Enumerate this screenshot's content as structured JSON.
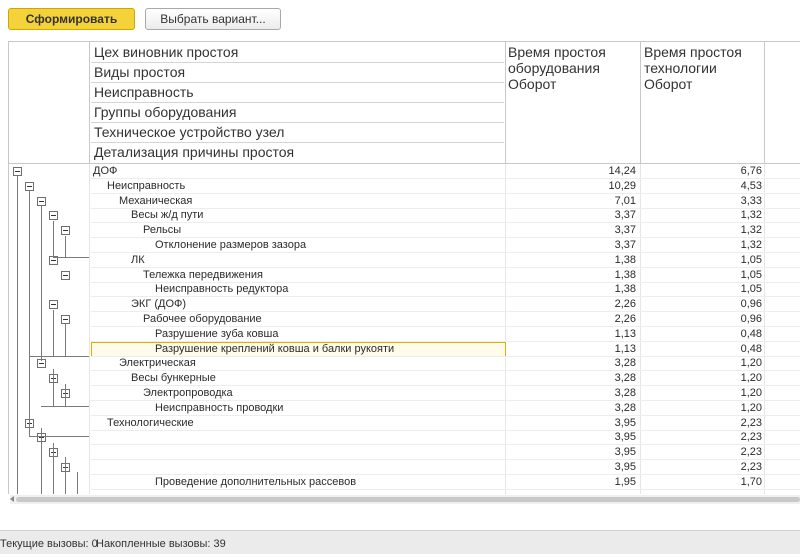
{
  "toolbar": {
    "generate_label": "Сформировать",
    "choose_variant_label": "Выбрать вариант..."
  },
  "header": {
    "groupings": [
      "Цех виновник простоя",
      "Виды простоя",
      "Неисправность",
      "Группы оборудования",
      "Техническое устройство узел",
      "Детализация причины простоя"
    ],
    "col1": "Время простоя\nоборудования\nОборот",
    "col2": "Время простоя\nтехнологии\nОборот"
  },
  "rows": [
    {
      "label": "ДОФ",
      "level": 0,
      "v1": "14,24",
      "v2": "6,76"
    },
    {
      "label": "Неисправность",
      "level": 1,
      "v1": "10,29",
      "v2": "4,53"
    },
    {
      "label": "Механическая",
      "level": 2,
      "v1": "7,01",
      "v2": "3,33"
    },
    {
      "label": "Весы ж/д пути",
      "level": 3,
      "v1": "3,37",
      "v2": "1,32"
    },
    {
      "label": "Рельсы",
      "level": 4,
      "v1": "3,37",
      "v2": "1,32"
    },
    {
      "label": "Отклонение размеров зазора",
      "level": 5,
      "v1": "3,37",
      "v2": "1,32"
    },
    {
      "label": "ЛК",
      "level": 3,
      "v1": "1,38",
      "v2": "1,05"
    },
    {
      "label": "Тележка передвижения",
      "level": 4,
      "v1": "1,38",
      "v2": "1,05"
    },
    {
      "label": "Неисправность редуктора",
      "level": 5,
      "v1": "1,38",
      "v2": "1,05"
    },
    {
      "label": "ЭКГ (ДОФ)",
      "level": 3,
      "v1": "2,26",
      "v2": "0,96"
    },
    {
      "label": "Рабочее оборудование",
      "level": 4,
      "v1": "2,26",
      "v2": "0,96"
    },
    {
      "label": "Разрушение зуба ковша",
      "level": 5,
      "v1": "1,13",
      "v2": "0,48"
    },
    {
      "label": "Разрушение креплений ковша и балки рукояти",
      "level": 5,
      "v1": "1,13",
      "v2": "0,48",
      "selected": true
    },
    {
      "label": "Электрическая",
      "level": 2,
      "v1": "3,28",
      "v2": "1,20"
    },
    {
      "label": "Весы бункерные",
      "level": 3,
      "v1": "3,28",
      "v2": "1,20"
    },
    {
      "label": "Электропроводка",
      "level": 4,
      "v1": "3,28",
      "v2": "1,20"
    },
    {
      "label": "Неисправность проводки",
      "level": 5,
      "v1": "3,28",
      "v2": "1,20"
    },
    {
      "label": "Технологические",
      "level": 1,
      "v1": "3,95",
      "v2": "2,23"
    },
    {
      "label": "",
      "level": 2,
      "v1": "3,95",
      "v2": "2,23"
    },
    {
      "label": "",
      "level": 3,
      "v1": "3,95",
      "v2": "2,23"
    },
    {
      "label": "",
      "level": 4,
      "v1": "3,95",
      "v2": "2,23"
    },
    {
      "label": "Проведение дополнительных рассевов",
      "level": 5,
      "v1": "1,95",
      "v2": "1,70"
    }
  ],
  "status": {
    "current_calls": "Текущие вызовы: 0",
    "accumulated_calls": "Накопленные вызовы: 39"
  }
}
